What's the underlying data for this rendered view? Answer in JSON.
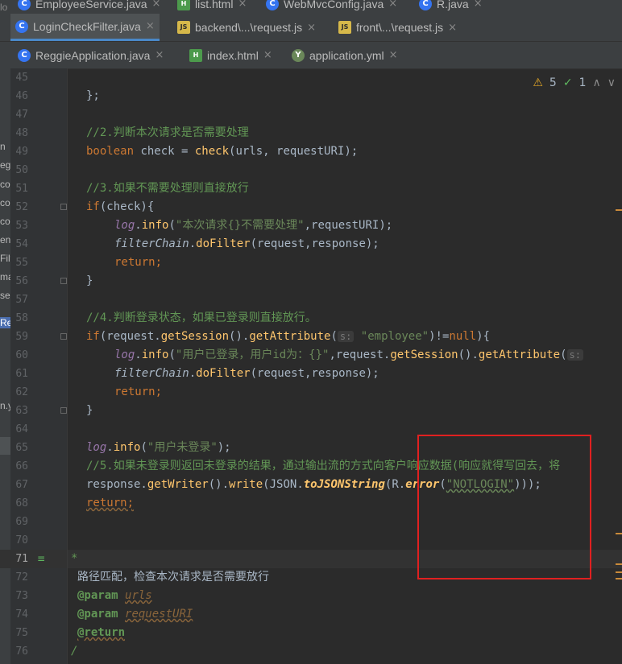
{
  "tabs": {
    "row0": [
      {
        "label": "EmployeeService.java",
        "icon": "C"
      },
      {
        "label": "list.html",
        "icon": "H"
      },
      {
        "label": "WebMvcConfig.java",
        "icon": "C"
      },
      {
        "label": "R.java",
        "icon": "C"
      }
    ],
    "row1": [
      {
        "label": "LoginCheckFilter.java",
        "icon": "C"
      },
      {
        "label": "backend\\...\\request.js",
        "icon": "JS"
      },
      {
        "label": "front\\...\\request.js",
        "icon": "JS"
      }
    ],
    "row2": [
      {
        "label": "ReggieApplication.java",
        "icon": "C"
      },
      {
        "label": "index.html",
        "icon": "H"
      },
      {
        "label": "application.yml",
        "icon": "Y"
      }
    ],
    "close_glyph": "×"
  },
  "inspections": {
    "warnings": "5",
    "ok": "1",
    "warn_glyph": "⚠",
    "ok_glyph": "✓",
    "up": "∧",
    "down": "∨"
  },
  "left_fragments": [
    "lo",
    "n",
    "eggi",
    "co",
    "co",
    "co",
    "en",
    "Filt",
    "ma",
    "se",
    "Re",
    "n.y"
  ],
  "lines": {
    "n45": "45",
    "n46": "46",
    "n47": "47",
    "n48": "48",
    "n49": "49",
    "n50": "50",
    "n51": "51",
    "n52": "52",
    "n53": "53",
    "n54": "54",
    "n55": "55",
    "n56": "56",
    "n57": "57",
    "n58": "58",
    "n59": "59",
    "n60": "60",
    "n61": "61",
    "n62": "62",
    "n63": "63",
    "n64": "64",
    "n65": "65",
    "n66": "66",
    "n67": "67",
    "n68": "68",
    "n69": "69",
    "n70": "70",
    "n71": "71",
    "n72": "72",
    "n73": "73",
    "n74": "74",
    "n75": "75",
    "n76": "76",
    "l46": "};",
    "l48": "//2.判断本次请求是否需要处理",
    "l49_kw": "boolean",
    "l49_a": " check = ",
    "l49_fn": "check",
    "l49_b": "(urls, requestURI);",
    "l51": "//3.如果不需要处理则直接放行",
    "l52_kw": "if",
    "l52_b": "(check){",
    "l53_field": "log",
    "l53_dot": ".",
    "l53_fn": "info",
    "l53_p": "(",
    "l53_str": "\"本次请求{}不需要处理\"",
    "l53_end": ",requestURI);",
    "l54_it": "filterChain",
    "l54_dot": ".",
    "l54_fn": "doFilter",
    "l54_end": "(request,response);",
    "l55": "return;",
    "l56": "}",
    "l58": "//4.判断登录状态，如果已登录则直接放行。",
    "l59_kw": "if",
    "l59_a": "(request.",
    "l59_fn1": "getSession",
    "l59_b": "().",
    "l59_fn2": "getAttribute",
    "l59_c": "(",
    "l59_hint": "s:",
    "l59_str": "\"employee\"",
    "l59_d": ")!=",
    "l59_null": "null",
    "l59_e": "){",
    "l60_field": "log",
    "l60_dot": ".",
    "l60_fn": "info",
    "l60_p": "(",
    "l60_str": "\"用户已登录，用户id为：{}\"",
    "l60_a": ",request.",
    "l60_fn1": "getSession",
    "l60_b": "().",
    "l60_fn2": "getAttribute",
    "l60_c": "(",
    "l60_hint": "s:",
    "l61_it": "filterChain",
    "l61_dot": ".",
    "l61_fn": "doFilter",
    "l61_end": "(request,response);",
    "l62": "return;",
    "l63": "}",
    "l65_field": "log",
    "l65_dot": ".",
    "l65_fn": "info",
    "l65_p": "(",
    "l65_str": "\"用户未登录\"",
    "l65_end": ");",
    "l66": "//5.如果未登录则返回未登录的结果，通过输出流的方式向客户响应数据(响应就得写回去，将",
    "l67_a": "response.",
    "l67_fn1": "getWriter",
    "l67_b": "().",
    "l67_fn2": "write",
    "l67_c": "(JSON.",
    "l67_st": "toJSONString",
    "l67_d": "(R.",
    "l67_st2": "error",
    "l67_e": "(",
    "l67_str": "\"NOTLOGIN\"",
    "l67_f": ")));",
    "l68": "return;",
    "l71": "*",
    "l72": "路径匹配，检查本次请求是否需要放行",
    "l73_tag": "@param",
    "l73_par": "urls",
    "l74_tag": "@param",
    "l74_par": "requestURI",
    "l75_tag": "@return",
    "l76": "/"
  }
}
